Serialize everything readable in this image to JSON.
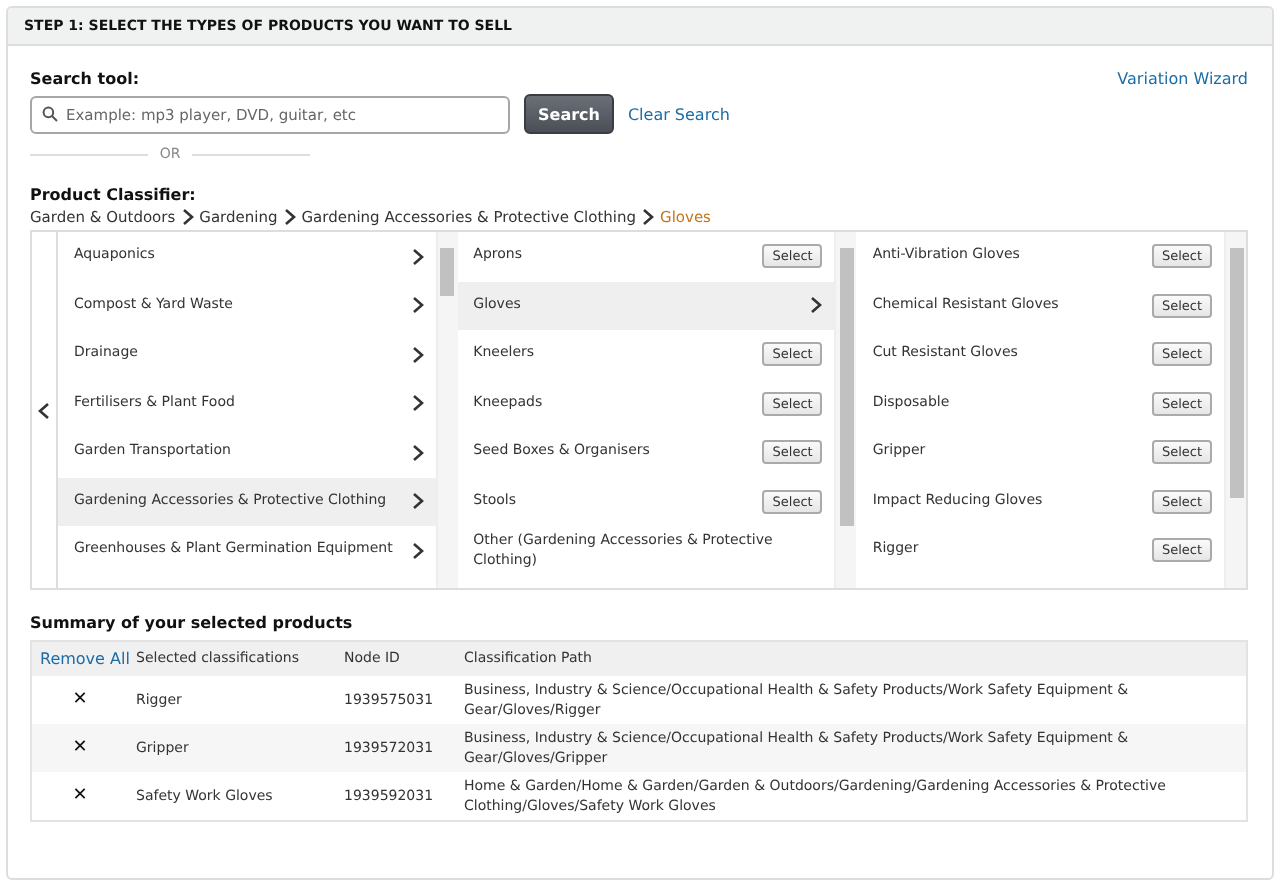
{
  "header": {
    "title": "STEP 1: SELECT THE TYPES OF PRODUCTS YOU WANT TO SELL"
  },
  "search": {
    "label": "Search tool:",
    "placeholder": "Example: mp3 player, DVD, guitar, etc",
    "button": "Search",
    "clear_link": "Clear Search",
    "wizard_link": "Variation Wizard",
    "divider_text": "OR"
  },
  "classifier": {
    "label": "Product Classifier:",
    "breadcrumb": [
      {
        "label": "Garden & Outdoors",
        "current": false
      },
      {
        "label": "Gardening",
        "current": false
      },
      {
        "label": "Gardening Accessories & Protective Clothing",
        "current": false
      },
      {
        "label": "Gloves",
        "current": true
      }
    ],
    "columns": [
      [
        {
          "label": "Aquaponics",
          "kind": "branch",
          "selected": false
        },
        {
          "label": "Compost & Yard Waste",
          "kind": "branch",
          "selected": false
        },
        {
          "label": "Drainage",
          "kind": "branch",
          "selected": false
        },
        {
          "label": "Fertilisers & Plant Food",
          "kind": "branch",
          "selected": false
        },
        {
          "label": "Garden Transportation",
          "kind": "branch",
          "selected": false
        },
        {
          "label": "Gardening Accessories & Protective Clothing",
          "kind": "branch",
          "selected": true
        },
        {
          "label": "Greenhouses & Plant Germination Equipment",
          "kind": "branch",
          "selected": false
        }
      ],
      [
        {
          "label": "Aprons",
          "kind": "select",
          "button": "Select",
          "selected": false
        },
        {
          "label": "Gloves",
          "kind": "branch",
          "selected": true
        },
        {
          "label": "Kneelers",
          "kind": "select",
          "button": "Select",
          "selected": false
        },
        {
          "label": "Kneepads",
          "kind": "select",
          "button": "Select",
          "selected": false
        },
        {
          "label": "Seed Boxes & Organisers",
          "kind": "select",
          "button": "Select",
          "selected": false
        },
        {
          "label": "Stools",
          "kind": "select",
          "button": "Select",
          "selected": false
        },
        {
          "label": "Other (Gardening Accessories & Protective Clothing)",
          "kind": "text",
          "selected": false
        }
      ],
      [
        {
          "label": "Anti-Vibration Gloves",
          "kind": "select",
          "button": "Select",
          "selected": false
        },
        {
          "label": "Chemical Resistant Gloves",
          "kind": "select",
          "button": "Select",
          "selected": false
        },
        {
          "label": "Cut Resistant Gloves",
          "kind": "select",
          "button": "Select",
          "selected": false
        },
        {
          "label": "Disposable",
          "kind": "select",
          "button": "Select",
          "selected": false
        },
        {
          "label": "Gripper",
          "kind": "select",
          "button": "Select",
          "selected": false
        },
        {
          "label": "Impact Reducing Gloves",
          "kind": "select",
          "button": "Select",
          "selected": false
        },
        {
          "label": "Rigger",
          "kind": "select",
          "button": "Select",
          "selected": false
        }
      ]
    ]
  },
  "summary": {
    "title": "Summary of your selected products",
    "columns": [
      "Remove All",
      "Selected classifications",
      "Node ID",
      "Classification Path"
    ],
    "rows": [
      {
        "remove": "✕",
        "classification": "Rigger",
        "node_id": "1939575031",
        "path": "Business, Industry & Science/Occupational Health & Safety Products/Work Safety Equipment & Gear/Gloves/Rigger"
      },
      {
        "remove": "✕",
        "classification": "Gripper",
        "node_id": "1939572031",
        "path": "Business, Industry & Science/Occupational Health & Safety Products/Work Safety Equipment & Gear/Gloves/Gripper"
      },
      {
        "remove": "✕",
        "classification": "Safety Work Gloves",
        "node_id": "1939592031",
        "path": "Home & Garden/Home & Garden/Garden & Outdoors/Gardening/Gardening Accessories & Protective Clothing/Gloves/Safety Work Gloves"
      }
    ]
  }
}
